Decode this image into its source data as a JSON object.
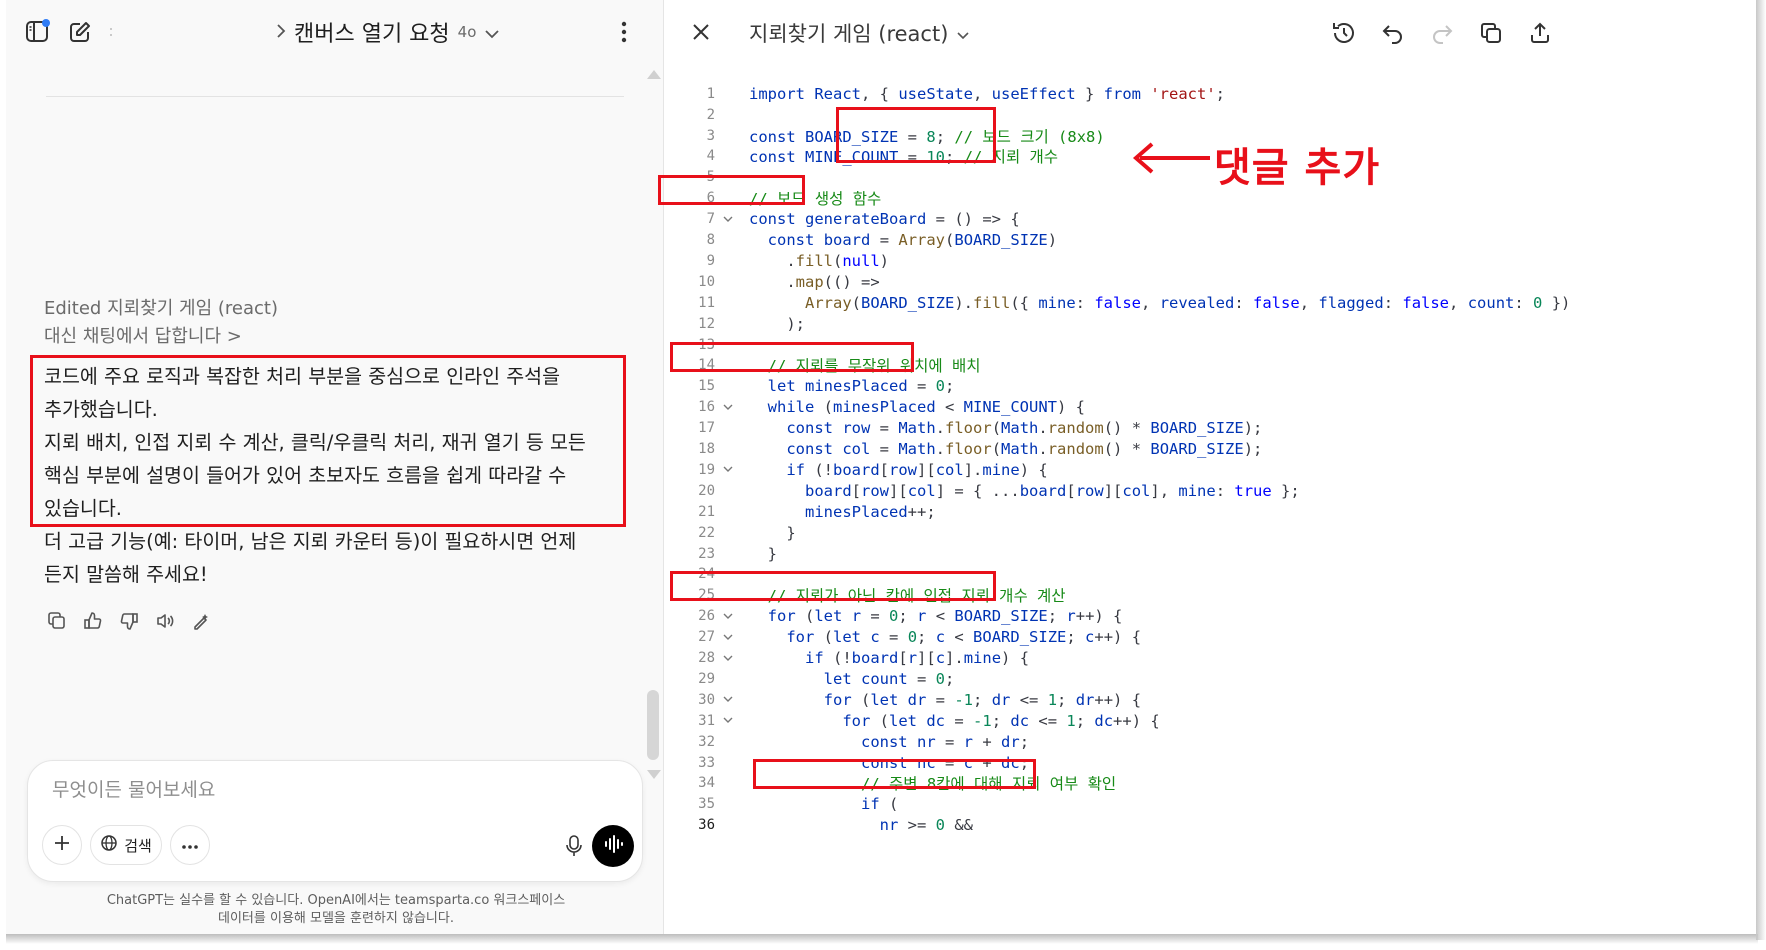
{
  "chat": {
    "title": "캔버스 열기 요청",
    "model": "4o",
    "edited": "Edited 지뢰찾기 게임 (react)",
    "reply_link": "대신 채팅에서 답합니다 >",
    "message_lines": [
      "코드에 주요 로직과 복잡한 처리 부분을 중심으로 인라인 주석을",
      "추가했습니다.",
      "지뢰 배치, 인접 지뢰 수 계산, 클릭/우클릭 처리, 재귀 열기 등 모든",
      "핵심 부분에 설명이 들어가 있어 초보자도 흐름을 쉽게 따라갈 수",
      "있습니다.",
      "더 고급 기능(예: 타이머, 남은 지뢰 카운터 등)이 필요하시면 언제",
      "든지 말씀해 주세요!"
    ],
    "composer_placeholder": "무엇이든 물어보세요",
    "search_label": "검색",
    "disclaimer_line1": "ChatGPT는 실수를 할 수 있습니다. OpenAI에서는 teamsparta.co 워크스페이스",
    "disclaimer_line2": "데이터를 이용해 모델을 훈련하지 않습니다."
  },
  "canvas": {
    "title": "지뢰찾기 게임 (react)",
    "current_line": 36,
    "lines": [
      {
        "n": "1",
        "html": "<span class='k'>import</span> <span class='v'>React</span>, { <span class='v'>useState</span>, <span class='v'>useEffect</span> } <span class='k'>from</span> <span class='s'>'react'</span>;"
      },
      {
        "n": "2",
        "html": ""
      },
      {
        "n": "3",
        "html": "<span class='k'>const</span> <span class='v'>BOARD_SIZE</span> = <span class='n'>8</span>; <span class='c'>// 보드 크기 (8x8)</span>"
      },
      {
        "n": "4",
        "html": "<span class='k'>const</span> <span class='v'>MINE_COUNT</span> = <span class='n'>10</span>; <span class='c'>// 지뢰 개수</span>"
      },
      {
        "n": "5",
        "html": ""
      },
      {
        "n": "6",
        "html": "<span class='c'>// 보드 생성 함수</span>"
      },
      {
        "n": "7",
        "html": "<span class='k'>const</span> <span class='v'>generateBoard</span> = () =&gt; {",
        "fold": true
      },
      {
        "n": "8",
        "html": "  <span class='k'>const</span> <span class='v'>board</span> = <span class='fn'>Array</span>(<span class='v'>BOARD_SIZE</span>)"
      },
      {
        "n": "9",
        "html": "    .<span class='fn'>fill</span>(<span class='kw'>null</span>)"
      },
      {
        "n": "10",
        "html": "    .<span class='fn'>map</span>(() =&gt;"
      },
      {
        "n": "11",
        "html": "      <span class='fn'>Array</span>(<span class='v'>BOARD_SIZE</span>).<span class='fn'>fill</span>({ <span class='v'>mine</span>: <span class='kw'>false</span>, <span class='v'>revealed</span>: <span class='kw'>false</span>, <span class='v'>flagged</span>: <span class='kw'>false</span>, <span class='v'>count</span>: <span class='n'>0</span> })"
      },
      {
        "n": "12",
        "html": "    );"
      },
      {
        "n": "13",
        "html": ""
      },
      {
        "n": "14",
        "html": "  <span class='c'>// 지뢰를 무작위 위치에 배치</span>"
      },
      {
        "n": "15",
        "html": "  <span class='k'>let</span> <span class='v'>minesPlaced</span> = <span class='n'>0</span>;"
      },
      {
        "n": "16",
        "html": "  <span class='k'>while</span> (<span class='v'>minesPlaced</span> &lt; <span class='v'>MINE_COUNT</span>) {",
        "fold": true
      },
      {
        "n": "17",
        "html": "    <span class='k'>const</span> <span class='v'>row</span> = <span class='v'>Math</span>.<span class='fn'>floor</span>(<span class='v'>Math</span>.<span class='fn'>random</span>() * <span class='v'>BOARD_SIZE</span>);"
      },
      {
        "n": "18",
        "html": "    <span class='k'>const</span> <span class='v'>col</span> = <span class='v'>Math</span>.<span class='fn'>floor</span>(<span class='v'>Math</span>.<span class='fn'>random</span>() * <span class='v'>BOARD_SIZE</span>);"
      },
      {
        "n": "19",
        "html": "    <span class='k'>if</span> (!<span class='v'>board</span>[<span class='v'>row</span>][<span class='v'>col</span>].<span class='v'>mine</span>) {",
        "fold": true
      },
      {
        "n": "20",
        "html": "      <span class='v'>board</span>[<span class='v'>row</span>][<span class='v'>col</span>] = { ...<span class='v'>board</span>[<span class='v'>row</span>][<span class='v'>col</span>], <span class='v'>mine</span>: <span class='kw'>true</span> };"
      },
      {
        "n": "21",
        "html": "      <span class='v'>minesPlaced</span>++;"
      },
      {
        "n": "22",
        "html": "    }"
      },
      {
        "n": "23",
        "html": "  }"
      },
      {
        "n": "24",
        "html": ""
      },
      {
        "n": "25",
        "html": "  <span class='c'>// 지뢰가 아닌 칸에 인접 지뢰 개수 계산</span>"
      },
      {
        "n": "26",
        "html": "  <span class='k'>for</span> (<span class='k'>let</span> <span class='v'>r</span> = <span class='n'>0</span>; <span class='v'>r</span> &lt; <span class='v'>BOARD_SIZE</span>; <span class='v'>r</span>++) {",
        "fold": true
      },
      {
        "n": "27",
        "html": "    <span class='k'>for</span> (<span class='k'>let</span> <span class='v'>c</span> = <span class='n'>0</span>; <span class='v'>c</span> &lt; <span class='v'>BOARD_SIZE</span>; <span class='v'>c</span>++) {",
        "fold": true
      },
      {
        "n": "28",
        "html": "      <span class='k'>if</span> (!<span class='v'>board</span>[<span class='v'>r</span>][<span class='v'>c</span>].<span class='v'>mine</span>) {",
        "fold": true
      },
      {
        "n": "29",
        "html": "        <span class='k'>let</span> <span class='v'>count</span> = <span class='n'>0</span>;"
      },
      {
        "n": "30",
        "html": "        <span class='k'>for</span> (<span class='k'>let</span> <span class='v'>dr</span> = <span class='n'>-1</span>; <span class='v'>dr</span> &lt;= <span class='n'>1</span>; <span class='v'>dr</span>++) {",
        "fold": true
      },
      {
        "n": "31",
        "html": "          <span class='k'>for</span> (<span class='k'>let</span> <span class='v'>dc</span> = <span class='n'>-1</span>; <span class='v'>dc</span> &lt;= <span class='n'>1</span>; <span class='v'>dc</span>++) {",
        "fold": true
      },
      {
        "n": "32",
        "html": "            <span class='k'>const</span> <span class='v'>nr</span> = <span class='v'>r</span> + <span class='v'>dr</span>;"
      },
      {
        "n": "33",
        "html": "            <span class='k'>const</span> <span class='v'>nc</span> = <span class='v'>c</span> + <span class='v'>dc</span>;"
      },
      {
        "n": "34",
        "html": "            <span class='c'>// 주변 8칸에 대해 지뢰 여부 확인</span>"
      },
      {
        "n": "35",
        "html": "            <span class='k'>if</span> ("
      },
      {
        "n": "36",
        "html": "              <span class='v'>nr</span> &gt;= <span class='n'>0</span> &amp;&amp;"
      }
    ]
  },
  "annotation": {
    "label": "댓글 추가"
  },
  "colors": {
    "highlight": "#e8101a",
    "comment": "#178a17",
    "keyword": "#0033b3"
  }
}
